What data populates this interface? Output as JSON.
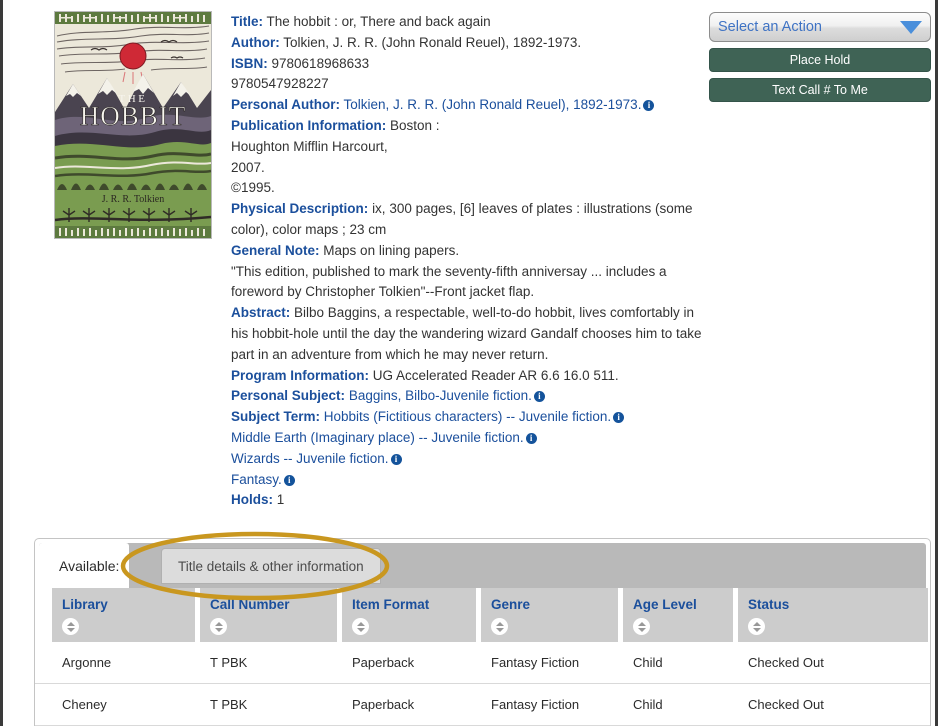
{
  "cover": {
    "alt_title": "THE HOBBIT",
    "title_small": "THE",
    "title_main": "HOBBIT",
    "author_line": "J. R. R. Tolkien"
  },
  "bib": {
    "rows": [
      {
        "label": "Title:",
        "value": "The hobbit : or, There and back again",
        "link": false,
        "info": false
      },
      {
        "label": "Author:",
        "value": "Tolkien, J. R. R. (John Ronald Reuel), 1892-1973.",
        "link": false,
        "info": false
      },
      {
        "label": "ISBN:",
        "value": "9780618968633",
        "link": false,
        "info": false
      },
      {
        "label": "",
        "value": "9780547928227",
        "link": false,
        "info": false
      },
      {
        "label": "Personal Author:",
        "value": "Tolkien, J. R. R. (John Ronald Reuel), 1892-1973.",
        "link": true,
        "info": true
      },
      {
        "label": "Publication Information:",
        "value": "Boston :",
        "link": false,
        "info": false
      },
      {
        "label": "",
        "value": "Houghton Mifflin Harcourt,",
        "link": false,
        "info": false
      },
      {
        "label": "",
        "value": "2007.",
        "link": false,
        "info": false
      },
      {
        "label": "",
        "value": "©1995.",
        "link": false,
        "info": false
      },
      {
        "label": "Physical Description:",
        "value": "ix, 300 pages, [6] leaves of plates : illustrations (some color), color maps ; 23 cm",
        "link": false,
        "info": false
      },
      {
        "label": "General Note:",
        "value": "Maps on lining papers.",
        "link": false,
        "info": false
      },
      {
        "label": "",
        "value": "\"This edition, published to mark the seventy-fifth anniversay ... includes a foreword by Christopher Tolkien\"--Front jacket flap.",
        "link": false,
        "info": false
      },
      {
        "label": "Abstract:",
        "value": "Bilbo Baggins, a respectable, well-to-do hobbit, lives comfortably in his hobbit-hole until the day the wandering wizard Gandalf chooses him to take part in an adventure from which he may never return.",
        "link": false,
        "info": false
      },
      {
        "label": "Program Information:",
        "value": "UG Accelerated Reader AR 6.6 16.0 511.",
        "link": false,
        "info": false
      },
      {
        "label": "Personal Subject:",
        "value": "Baggins, Bilbo-Juvenile fiction.",
        "link": true,
        "info": true
      },
      {
        "label": "Subject Term:",
        "value": "Hobbits (Fictitious characters) -- Juvenile fiction.",
        "link": true,
        "info": true
      },
      {
        "label": "",
        "value": "Middle Earth (Imaginary place) -- Juvenile fiction.",
        "link": true,
        "info": true
      },
      {
        "label": "",
        "value": "Wizards -- Juvenile fiction.",
        "link": true,
        "info": true
      },
      {
        "label": "",
        "value": "Fantasy.",
        "link": true,
        "info": true
      },
      {
        "label": "Holds:",
        "value": "1",
        "link": false,
        "info": false
      }
    ]
  },
  "actions": {
    "select_label": "Select an Action",
    "place_hold_label": "Place Hold",
    "text_call_label": "Text Call # To Me"
  },
  "tabs": {
    "available_label": "Available:",
    "details_label": "Title details & other information"
  },
  "table": {
    "columns": [
      {
        "label": "Library",
        "width_class": "w-library"
      },
      {
        "label": "Call Number",
        "width_class": "w-call"
      },
      {
        "label": "Item Format",
        "width_class": "w-format"
      },
      {
        "label": "Genre",
        "width_class": "w-genre"
      },
      {
        "label": "Age Level",
        "width_class": "w-age"
      },
      {
        "label": "Status",
        "width_class": "w-status"
      }
    ],
    "rows": [
      {
        "library": "Argonne",
        "call": "T PBK",
        "format": "Paperback",
        "genre": "Fantasy Fiction",
        "age": "Child",
        "status": "Checked Out"
      },
      {
        "library": "Cheney",
        "call": "T PBK",
        "format": "Paperback",
        "genre": "Fantasy Fiction",
        "age": "Child",
        "status": "Checked Out"
      }
    ]
  },
  "annotation": {
    "shape": "ellipse-highlight",
    "color": "#c9971f",
    "targets": "details-tab"
  },
  "colors": {
    "label_blue": "#1b4f9c",
    "button_green": "#3f6355",
    "annotation_gold": "#c9971f",
    "header_gray": "#cccccc",
    "tabbar_gray": "#b9b9b9"
  }
}
